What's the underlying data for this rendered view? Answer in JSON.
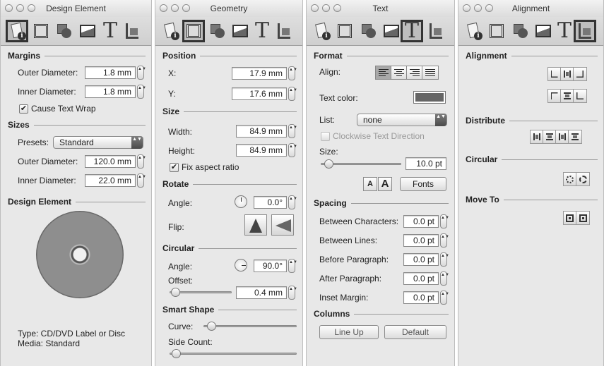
{
  "panels": {
    "design": {
      "title": "Design Element",
      "sections": {
        "margins": "Margins",
        "sizes": "Sizes",
        "design_element": "Design Element"
      },
      "outer_diameter_label": "Outer Diameter:",
      "outer_diameter_value": "1.8 mm",
      "inner_diameter_label": "Inner Diameter:",
      "inner_diameter_value": "1.8 mm",
      "cause_text_wrap_label": "Cause Text Wrap",
      "cause_text_wrap_checked": "✔",
      "presets_label": "Presets:",
      "presets_value": "Standard",
      "size_outer_label": "Outer Diameter:",
      "size_outer_value": "120.0 mm",
      "size_inner_label": "Inner Diameter:",
      "size_inner_value": "22.0 mm",
      "type_text": "Type: CD/DVD Label or Disc",
      "media_text": "Media: Standard"
    },
    "geometry": {
      "title": "Geometry",
      "sections": {
        "position": "Position",
        "size": "Size",
        "rotate": "Rotate",
        "circular": "Circular",
        "smart_shape": "Smart Shape"
      },
      "x_label": "X:",
      "x_value": "17.9 mm",
      "y_label": "Y:",
      "y_value": "17.6 mm",
      "width_label": "Width:",
      "width_value": "84.9 mm",
      "height_label": "Height:",
      "height_value": "84.9 mm",
      "aspect_label": "Fix aspect ratio",
      "aspect_checked": "✔",
      "angle_label": "Angle:",
      "angle_value": "0.0°",
      "flip_label": "Flip:",
      "circ_angle_label": "Angle:",
      "circ_angle_value": "90.0°",
      "offset_label": "Offset:",
      "offset_value": "0.4 mm",
      "offset_slider_fraction": 0.03,
      "curve_label": "Curve:",
      "curve_slider_fraction": 0.04,
      "side_count_label": "Side Count:",
      "side_count_slider_fraction": 0.02
    },
    "text": {
      "title": "Text",
      "sections": {
        "format": "Format",
        "spacing": "Spacing",
        "columns": "Columns"
      },
      "align_label": "Align:",
      "text_color_label": "Text color:",
      "text_color": "#666666",
      "list_label": "List:",
      "list_value": "none",
      "clockwise_label": "Clockwise Text Direction",
      "size_label": "Size:",
      "size_value": "10.0 pt",
      "size_slider_fraction": 0.05,
      "small_a": "A",
      "big_a": "A",
      "fonts_button": "Fonts",
      "between_chars_label": "Between Characters:",
      "between_chars_value": "0.0 pt",
      "between_lines_label": "Between Lines:",
      "between_lines_value": "0.0 pt",
      "before_para_label": "Before Paragraph:",
      "before_para_value": "0.0 pt",
      "after_para_label": "After Paragraph:",
      "after_para_value": "0.0 pt",
      "inset_label": "Inset Margin:",
      "inset_value": "0.0 pt",
      "line_up_button": "Line Up",
      "default_button": "Default"
    },
    "alignment": {
      "title": "Alignment",
      "sections": {
        "alignment": "Alignment",
        "distribute": "Distribute",
        "circular": "Circular",
        "move_to": "Move To"
      }
    }
  },
  "toolbar_icons": [
    "design-element-icon",
    "geometry-icon",
    "shape-icon",
    "image-icon",
    "text-icon",
    "alignment-icon"
  ],
  "stepper_glyph": "▲▼",
  "popup_glyph": "▲▼"
}
